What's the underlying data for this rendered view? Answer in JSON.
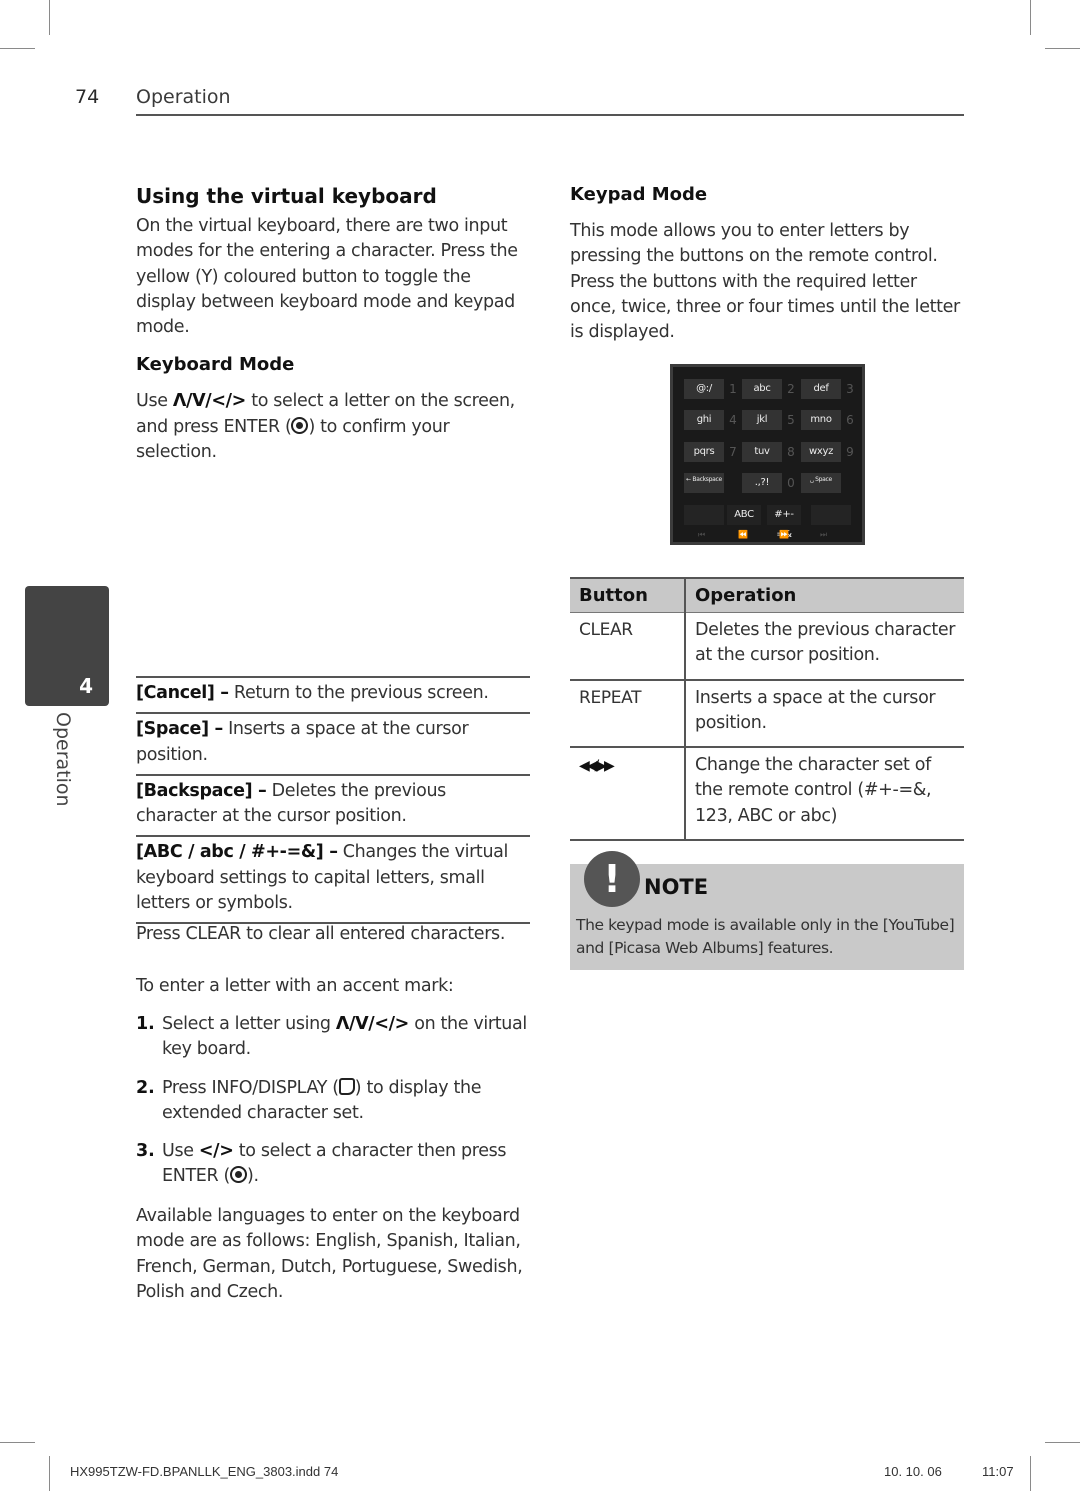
{
  "header": {
    "page_number": "74",
    "section": "Operation"
  },
  "side_tab": {
    "chapter_number": "4",
    "chapter_label": "Operation"
  },
  "left": {
    "title": "Using the virtual keyboard",
    "intro": "On the virtual keyboard, there are two input modes for the entering a character. Press the yellow (Y) coloured button to toggle the display between keyboard mode and keypad mode.",
    "keyboard_mode": {
      "heading": "Keyboard Mode",
      "text_before": "Use ",
      "nav_glyphs": "Λ/V/</>",
      "text_mid": " to select a letter on the screen, and press ENTER (",
      "text_after": ") to confirm your selection."
    },
    "definitions": [
      {
        "term": "[Cancel] –",
        "desc": " Return to the previous screen."
      },
      {
        "term": "[Space] –",
        "desc": " Inserts a space at the cursor position."
      },
      {
        "term": "[Backspace] –",
        "desc": " Deletes the previous character at the cursor position."
      },
      {
        "term": "[ABC / abc / #+-=&] –",
        "desc": " Changes the virtual keyboard settings to capital letters, small letters or symbols."
      }
    ],
    "press_clear": "Press CLEAR to clear all entered characters.",
    "accent_intro": "To enter a letter with an accent mark:",
    "steps": [
      {
        "num": "1.",
        "before": "Select a letter using ",
        "glyphs": "Λ/V/</>",
        "after": " on the virtual key board."
      },
      {
        "num": "2.",
        "before": "Press INFO/DISPLAY (",
        "after": ") to display the extended character set."
      },
      {
        "num": "3.",
        "before": "Use ",
        "glyphs": "</>",
        "mid": " to select a character then press ENTER (",
        "after": ")."
      }
    ],
    "languages": "Available languages to enter on the keyboard mode are as follows: English, Spanish, Italian, French, German, Dutch, Portuguese, Swedish, Polish and Czech."
  },
  "right": {
    "keypad_mode": {
      "heading": "Keypad Mode",
      "text": "This mode allows you to enter letters by pressing the buttons on the remote control. Press the buttons with the required letter once, twice, three or four times until the letter is displayed."
    },
    "keypad_image": {
      "keys": [
        {
          "label": "@:/",
          "num": "1"
        },
        {
          "label": "abc",
          "num": "2"
        },
        {
          "label": "def",
          "num": "3"
        },
        {
          "label": "ghi",
          "num": "4"
        },
        {
          "label": "jkl",
          "num": "5"
        },
        {
          "label": "mno",
          "num": "6"
        },
        {
          "label": "pqrs",
          "num": "7"
        },
        {
          "label": "tuv",
          "num": "8"
        },
        {
          "label": "wxyz",
          "num": "9"
        },
        {
          "label": "← Backspace",
          "num": ""
        },
        {
          "label": ".,?!",
          "num": "0"
        },
        {
          "label": "␣ Space",
          "num": ""
        }
      ],
      "mode_keys": [
        "ABC",
        "#+-=&"
      ],
      "controls": [
        "⏮",
        "⏪",
        "⏩",
        "⏭"
      ]
    },
    "table": {
      "headers": [
        "Button",
        "Operation"
      ],
      "rows": [
        {
          "button": "CLEAR",
          "operation": "Deletes the previous character at the cursor position."
        },
        {
          "button": "REPEAT",
          "operation": "Inserts a space at the cursor position."
        },
        {
          "button": "◀◀/▶▶",
          "operation": "Change the character set of the remote control (#+-=&, 123, ABC or abc)"
        }
      ]
    },
    "note": {
      "icon": "!",
      "title": "NOTE",
      "text": "The keypad mode is available only in the [YouTube] and [Picasa Web Albums] features."
    }
  },
  "footer": {
    "file": "HX995TZW-FD.BPANLLK_ENG_3803.indd   74",
    "date": "10. 10. 06",
    "time": "11:07"
  }
}
